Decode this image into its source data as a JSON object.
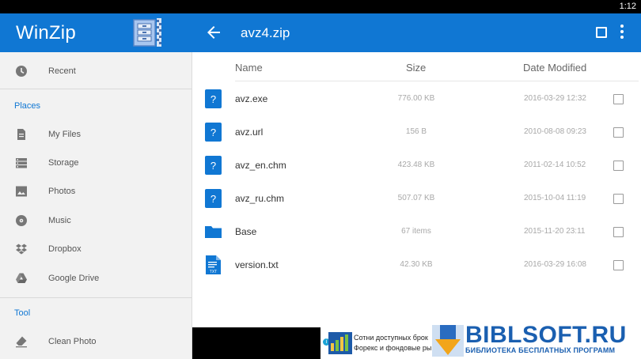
{
  "status_bar": {
    "time": "1:12"
  },
  "app_bar": {
    "brand": "WinZip",
    "title": "avz4.zip",
    "colors": {
      "bar": "#1077d3",
      "text": "#ffffff"
    }
  },
  "sidebar": {
    "top_items": [
      {
        "label": "Recent",
        "icon": "clock-icon"
      }
    ],
    "places_label": "Places",
    "places": [
      {
        "label": "My Files",
        "icon": "document-icon"
      },
      {
        "label": "Storage",
        "icon": "storage-icon"
      },
      {
        "label": "Photos",
        "icon": "image-icon"
      },
      {
        "label": "Music",
        "icon": "music-icon"
      },
      {
        "label": "Dropbox",
        "icon": "dropbox-icon"
      },
      {
        "label": "Google Drive",
        "icon": "google-drive-icon"
      }
    ],
    "tool_label": "Tool",
    "tools": [
      {
        "label": "Clean Photo",
        "icon": "eraser-icon"
      }
    ]
  },
  "file_list": {
    "headers": {
      "name": "Name",
      "size": "Size",
      "date": "Date Modified"
    },
    "files": [
      {
        "name": "avz.exe",
        "size": "776.00 KB",
        "date": "2016-03-29 12:32",
        "icon": "unknown-file-icon"
      },
      {
        "name": "avz.url",
        "size": "156 B",
        "date": "2010-08-08 09:23",
        "icon": "unknown-file-icon"
      },
      {
        "name": "avz_en.chm",
        "size": "423.48 KB",
        "date": "2011-02-14 10:52",
        "icon": "unknown-file-icon"
      },
      {
        "name": "avz_ru.chm",
        "size": "507.07 KB",
        "date": "2015-10-04 11:19",
        "icon": "unknown-file-icon"
      },
      {
        "name": "Base",
        "size": "67 items",
        "date": "2015-11-20 23:11",
        "icon": "folder-icon"
      },
      {
        "name": "version.txt",
        "size": "42.30 KB",
        "date": "2016-03-29 16:08",
        "icon": "text-file-icon"
      }
    ]
  },
  "ad": {
    "line1": "Сотни доступных брок",
    "line2": "Форекс и фондовые ры"
  },
  "watermark": {
    "title": "BIBLSOFT.RU",
    "subtitle": "БИБЛИОТЕКА БЕСПЛАТНЫХ ПРОГРАММ"
  },
  "accent_color": "#1077d3"
}
